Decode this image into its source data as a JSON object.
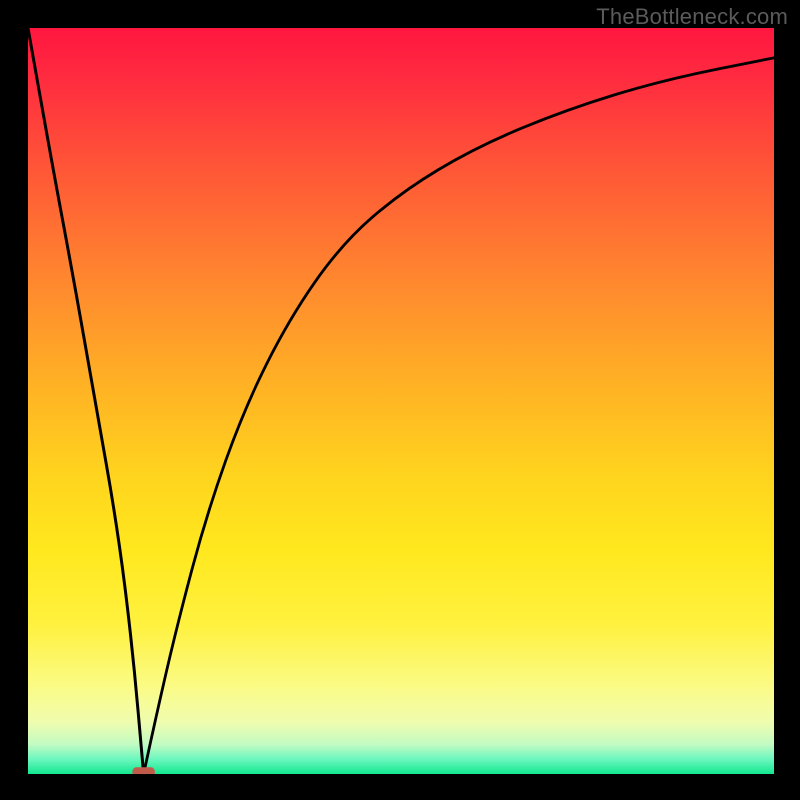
{
  "watermark": {
    "text": "TheBottleneck.com"
  },
  "chart_data": {
    "type": "line",
    "title": "",
    "xlabel": "",
    "ylabel": "",
    "xlim": [
      0,
      100
    ],
    "ylim": [
      0,
      100
    ],
    "grid": false,
    "legend": false,
    "series": [
      {
        "name": "left-branch",
        "x": [
          0,
          3,
          6,
          9,
          12,
          14,
          15.5
        ],
        "y": [
          100,
          83,
          67,
          50,
          33,
          17,
          0
        ]
      },
      {
        "name": "right-branch",
        "x": [
          15.5,
          17,
          20,
          24,
          29,
          35,
          42,
          50,
          60,
          72,
          85,
          100
        ],
        "y": [
          0,
          7,
          20,
          35,
          49,
          61,
          71,
          78,
          84,
          89,
          93,
          96
        ]
      }
    ],
    "marker": {
      "name": "cusp-marker",
      "x": 15.5,
      "y": 0,
      "color": "#c05a4a",
      "width": 3,
      "height": 1.8
    },
    "background_gradient": {
      "stops": [
        {
          "pct": 0,
          "color": "#ff163f"
        },
        {
          "pct": 20,
          "color": "#ff5a36"
        },
        {
          "pct": 48,
          "color": "#ffb224"
        },
        {
          "pct": 70,
          "color": "#ffe81e"
        },
        {
          "pct": 93,
          "color": "#f0fcae"
        },
        {
          "pct": 100,
          "color": "#12e88e"
        }
      ]
    }
  }
}
